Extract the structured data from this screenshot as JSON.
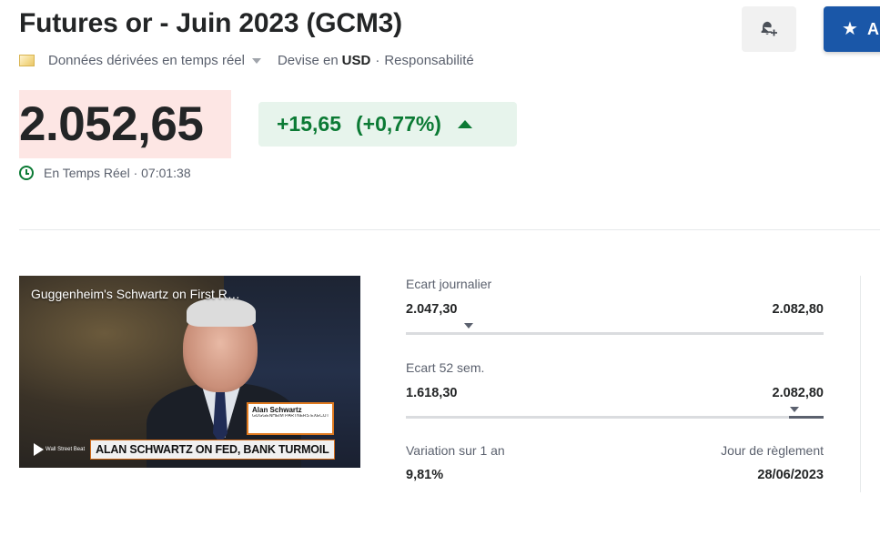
{
  "header": {
    "title": "Futures or - Juin 2023 (GCM3)",
    "alert_icon": "bell-plus-icon",
    "watchlist_icon": "star-icon",
    "watchlist_label": "A"
  },
  "meta": {
    "flag_icon": "gold-flag-icon",
    "data_label": "Données dérivées en temps réel",
    "currency_prefix": "Devise en",
    "currency": "USD",
    "separator": "·",
    "responsibility": "Responsabilité"
  },
  "quote": {
    "price": "2.052,65",
    "change": "+15,65",
    "change_pct": "(+0,77%)",
    "direction": "up",
    "realtime_label": "En Temps Réel · 07:01:38"
  },
  "video": {
    "title": "Guggenheim's Schwartz on First R…",
    "nameplate_name": "Alan Schwartz",
    "nameplate_role": "GUGGENHEIM PARTNERS EXECUTIVE CHAIRMAN",
    "brand": "Wall Street Beat",
    "headline": "ALAN SCHWARTZ ON FED, BANK TURMOIL"
  },
  "stats": {
    "daily_range": {
      "label": "Ecart journalier",
      "low": "2.047,30",
      "high": "2.082,80",
      "marker_fraction": 0.15
    },
    "week52_range": {
      "label": "Ecart 52 sem.",
      "low": "1.618,30",
      "high": "2.082,80",
      "marker_fraction": 0.93
    },
    "change_1y": {
      "label": "Variation sur 1 an",
      "value": "9,81%"
    },
    "settlement": {
      "label": "Jour de règlement",
      "value": "28/06/2023"
    }
  },
  "colors": {
    "positive": "#0b7a34",
    "positive_bg": "#e7f4ec",
    "price_highlight": "#fde6e4",
    "accent_blue": "#1a57a8"
  }
}
